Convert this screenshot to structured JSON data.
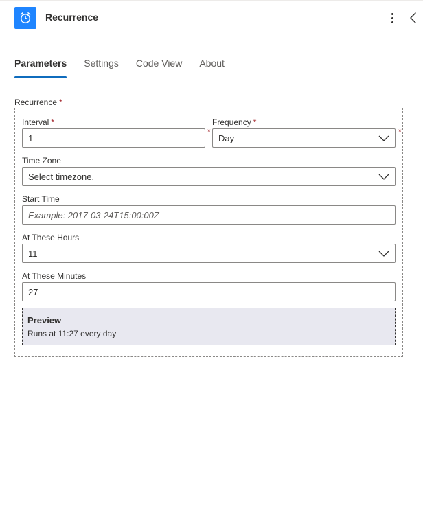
{
  "header": {
    "title": "Recurrence",
    "icon": "alarm-clock-icon",
    "accent": "#1f85ff"
  },
  "tabs": [
    {
      "label": "Parameters",
      "active": true
    },
    {
      "label": "Settings",
      "active": false
    },
    {
      "label": "Code View",
      "active": false
    },
    {
      "label": "About",
      "active": false
    }
  ],
  "recurrence": {
    "label": "Recurrence",
    "required_mark": "*",
    "interval": {
      "label": "Interval",
      "required_mark": "*",
      "value": "1"
    },
    "frequency": {
      "label": "Frequency",
      "required_mark": "*",
      "value": "Day"
    },
    "time_zone": {
      "label": "Time Zone",
      "value": "Select timezone."
    },
    "start_time": {
      "label": "Start Time",
      "placeholder": "Example: 2017-03-24T15:00:00Z"
    },
    "at_these_hours": {
      "label": "At These Hours",
      "value": "11"
    },
    "at_these_minutes": {
      "label": "At These Minutes",
      "value": "27"
    },
    "preview": {
      "title": "Preview",
      "text": "Runs at 11:27 every day"
    }
  }
}
